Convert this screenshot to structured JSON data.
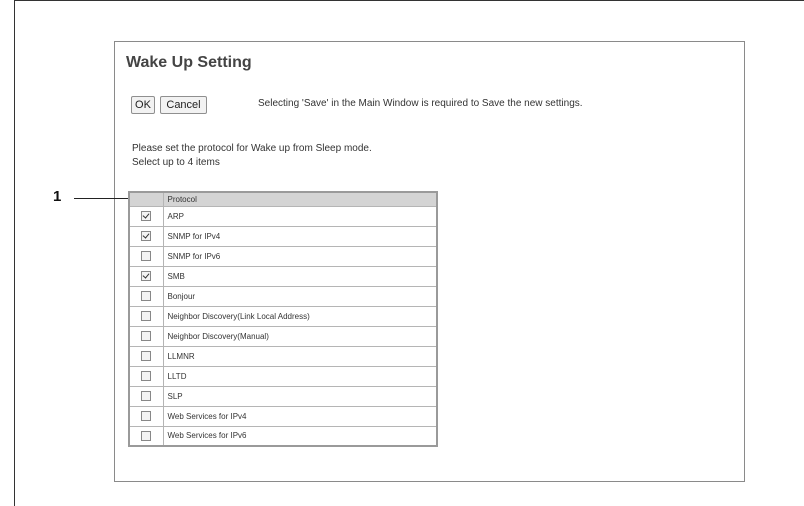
{
  "dialog": {
    "title": "Wake Up Setting",
    "ok_label": "OK",
    "cancel_label": "Cancel",
    "save_note": "Selecting 'Save' in the Main Window is required to Save the new settings.",
    "instruction_1": "Please set the protocol for Wake up from Sleep mode.",
    "instruction_2": "Select up to 4 items"
  },
  "callout": {
    "number": "1"
  },
  "table": {
    "header_protocol": "Protocol",
    "rows": [
      {
        "name": "ARP",
        "checked": true
      },
      {
        "name": "SNMP for IPv4",
        "checked": true
      },
      {
        "name": "SNMP for IPv6",
        "checked": false
      },
      {
        "name": "SMB",
        "checked": true
      },
      {
        "name": "Bonjour",
        "checked": false
      },
      {
        "name": "Neighbor Discovery(Link Local Address)",
        "checked": false
      },
      {
        "name": "Neighbor Discovery(Manual)",
        "checked": false
      },
      {
        "name": "LLMNR",
        "checked": false
      },
      {
        "name": "LLTD",
        "checked": false
      },
      {
        "name": "SLP",
        "checked": false
      },
      {
        "name": "Web Services for IPv4",
        "checked": false
      },
      {
        "name": "Web Services for IPv6",
        "checked": false
      }
    ]
  }
}
